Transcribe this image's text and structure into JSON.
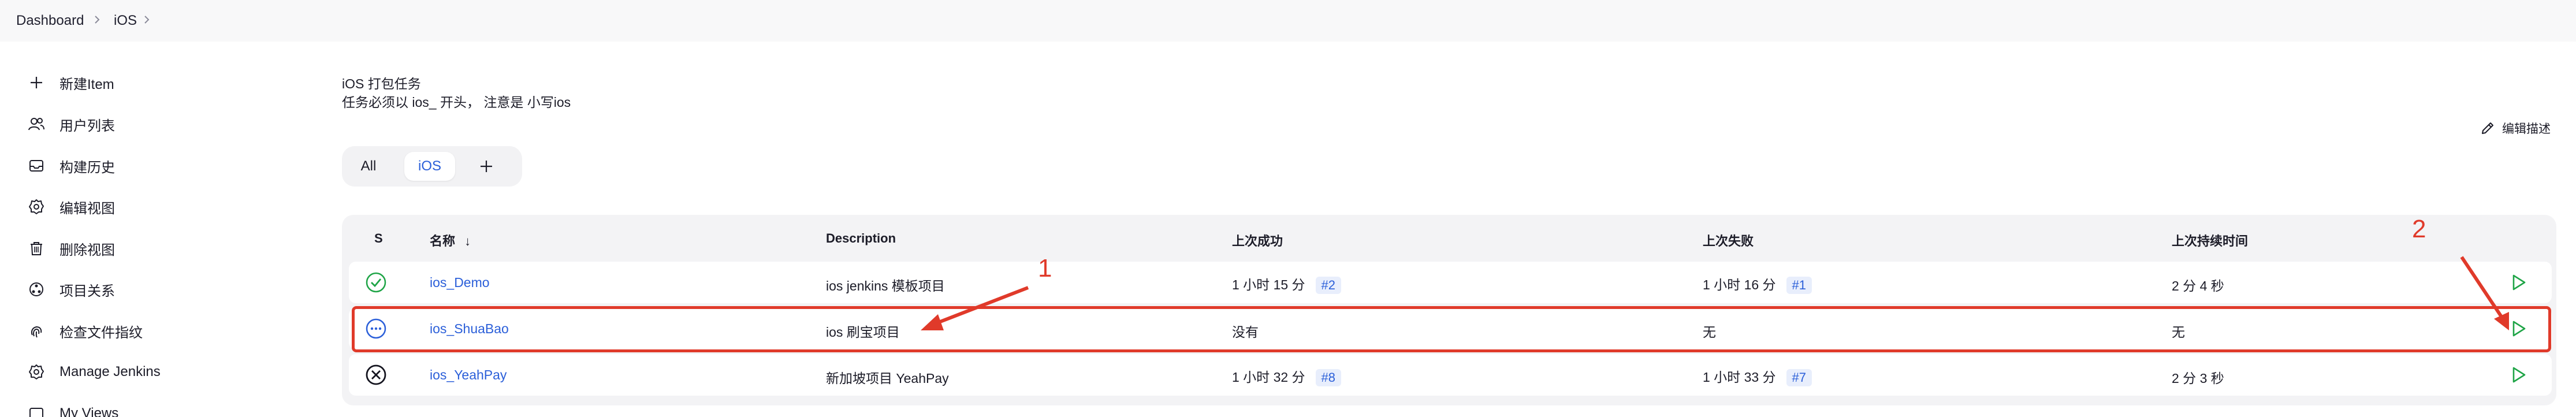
{
  "breadcrumb": {
    "items": [
      "Dashboard",
      "iOS"
    ]
  },
  "sidebar": {
    "items": [
      {
        "label": "新建Item",
        "icon": "plus-icon"
      },
      {
        "label": "用户列表",
        "icon": "users-icon"
      },
      {
        "label": "构建历史",
        "icon": "inbox-icon"
      },
      {
        "label": "编辑视图",
        "icon": "gear-icon"
      },
      {
        "label": "删除视图",
        "icon": "trash-icon"
      },
      {
        "label": "项目关系",
        "icon": "relationship-icon"
      },
      {
        "label": "检查文件指纹",
        "icon": "fingerprint-icon"
      },
      {
        "label": "Manage Jenkins",
        "icon": "gear-icon"
      },
      {
        "label": "My Views",
        "icon": "views-icon"
      }
    ]
  },
  "description": {
    "line1": "iOS 打包任务",
    "line2": "任务必须以 ios_ 开头， 注意是 小写ios"
  },
  "edit_description": {
    "label": "编辑描述",
    "icon": "pencil-icon"
  },
  "tabs": [
    {
      "label": "All"
    },
    {
      "label": "iOS",
      "active": true
    },
    {
      "icon": "plus-icon"
    }
  ],
  "table": {
    "headers": {
      "status": "S",
      "name": "名称",
      "name_sort": "↓",
      "description": "Description",
      "last_success": "上次成功",
      "last_failure": "上次失败",
      "last_duration": "上次持续时间"
    },
    "rows": [
      {
        "status": "success",
        "status_icon": "check-circle-icon",
        "name": "ios_Demo",
        "description": "ios jenkins 模板项目",
        "last_success": "1 小时 15 分",
        "last_success_build": "#2",
        "last_failure": "1 小时 16 分",
        "last_failure_build": "#1",
        "last_duration": "2 分 4 秒"
      },
      {
        "status": "not built",
        "status_icon": "dots-circle-icon",
        "name": "ios_ShuaBao",
        "description": "ios 刷宝项目",
        "last_success": "没有",
        "last_success_build": "",
        "last_failure": "无",
        "last_failure_build": "",
        "last_duration": "无"
      },
      {
        "status": "failed",
        "status_icon": "x-circle-icon",
        "name": "ios_YeahPay",
        "description": "新加坡项目 YeahPay",
        "last_success": "1 小时 32 分",
        "last_success_build": "#8",
        "last_failure": "1 小时 33 分",
        "last_failure_build": "#7",
        "last_duration": "2 分 3 秒"
      }
    ],
    "run_icon": "play-icon"
  },
  "annotations": {
    "label1": "1",
    "label2": "2",
    "color": "#e03a2a"
  },
  "colors": {
    "link": "#2b5fd9",
    "success": "#1ea446",
    "accent_red": "#e03a2a"
  }
}
